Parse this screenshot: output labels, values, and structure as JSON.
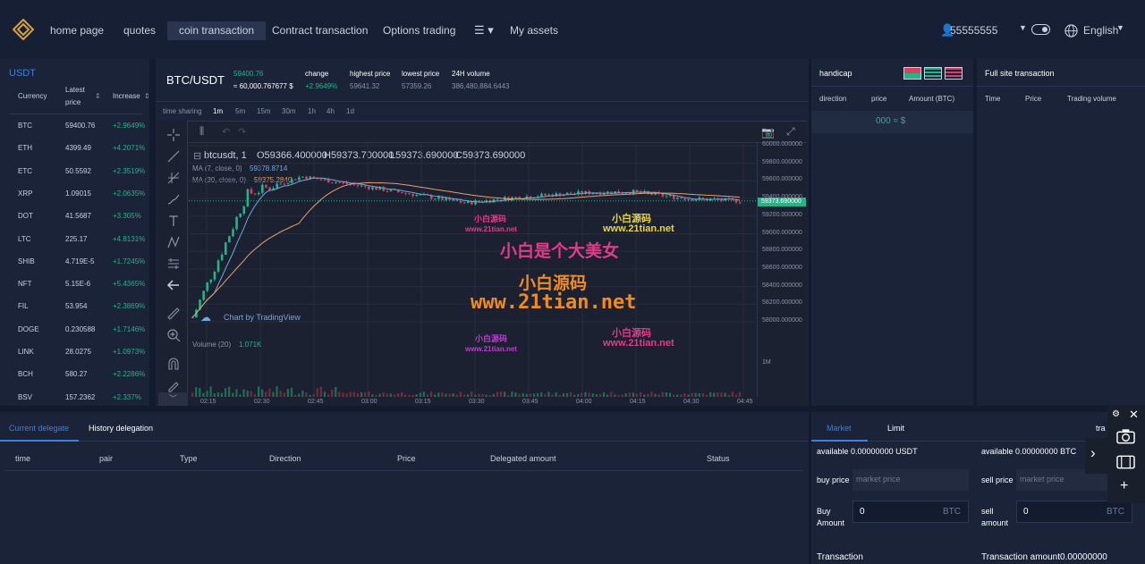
{
  "nav": {
    "items": [
      "home page",
      "quotes",
      "coin transaction",
      "Contract transaction",
      "Options trading",
      "My assets"
    ],
    "active": "coin transaction",
    "user": "55555555",
    "language": "English"
  },
  "market_list": {
    "title": "USDT",
    "headers": {
      "currency": "Currency",
      "latest_price_1": "Latest",
      "latest_price_2": "price",
      "increase": "Increase"
    },
    "rows": [
      {
        "currency": "BTC",
        "price": "59400.76",
        "increase": "+2.9649%"
      },
      {
        "currency": "ETH",
        "price": "4399.49",
        "increase": "+4.2071%"
      },
      {
        "currency": "ETC",
        "price": "50.5592",
        "increase": "+2.3519%"
      },
      {
        "currency": "XRP",
        "price": "1.09015",
        "increase": "+2.0635%"
      },
      {
        "currency": "DOT",
        "price": "41.5687",
        "increase": "+3.305%"
      },
      {
        "currency": "LTC",
        "price": "225.17",
        "increase": "+4.8131%"
      },
      {
        "currency": "SHIB",
        "price": "4.719E-5",
        "increase": "+1.7245%"
      },
      {
        "currency": "NFT",
        "price": "5.15E-6",
        "increase": "+5.4365%"
      },
      {
        "currency": "FIL",
        "price": "53.954",
        "increase": "+2.3869%"
      },
      {
        "currency": "DOGE",
        "price": "0.230588",
        "increase": "+1.7146%"
      },
      {
        "currency": "LINK",
        "price": "28.0275",
        "increase": "+1.0973%"
      },
      {
        "currency": "BCH",
        "price": "580.27",
        "increase": "+2.2286%"
      },
      {
        "currency": "BSV",
        "price": "157.2362",
        "increase": "+2.337%"
      }
    ]
  },
  "ticker": {
    "pair": "BTC/USDT",
    "last": "59400.76",
    "last_fiat": "≈ 60,000.767677 $",
    "change_label": "change",
    "change": "+2.9649%",
    "high_label": "highest price",
    "high": "59641.32",
    "low_label": "lowest price",
    "low": "57359.26",
    "vol_label": "24H volume",
    "vol": "386,480,884.6443"
  },
  "timeframes": [
    "time sharing",
    "1m",
    "5m",
    "15m",
    "30m",
    "1h",
    "4h",
    "1d"
  ],
  "active_timeframe": "1m",
  "chart": {
    "symbol": "btcusdt, 1",
    "ohlc": {
      "o": "O59366.400000",
      "h": "H59373.700000",
      "l": "L59373.690000",
      "c": "C59373.690000"
    },
    "ma7_label": "MA (7, close, 0)",
    "ma7_value": "59378.8714",
    "ma30_label": "MA (30, close, 0)",
    "ma30_value": "59375.2840",
    "volume_label": "Volume (20)",
    "volume_value": "1.071K",
    "credit": "Chart by TradingView",
    "last_price_tag": "59373.690000",
    "y_ticks": [
      "60000.000000",
      "59800.000000",
      "59600.000000",
      "59400.000000",
      "59200.000000",
      "59000.000000",
      "58800.000000",
      "58600.000000",
      "58400.000000",
      "58200.000000",
      "58000.000000"
    ],
    "vol_tick": "1M",
    "x_ticks": [
      "02:15",
      "02:30",
      "02:45",
      "03:00",
      "03:15",
      "03:30",
      "03:45",
      "04:00",
      "04:15",
      "04:30",
      "04:45"
    ],
    "watermarks": [
      "小白源码",
      "www.21tian.net",
      "小白源码",
      "www.21tian.net",
      "小白是个大美女",
      "小白源码",
      "www.21tian.net",
      "小白源码",
      "www.21tian.net",
      "小白源码",
      "www.21tian.net"
    ]
  },
  "chart_data": {
    "type": "line",
    "x": [
      "02:15",
      "02:30",
      "02:45",
      "03:00",
      "03:15",
      "03:30",
      "03:45",
      "04:00",
      "04:15",
      "04:30",
      "04:45"
    ],
    "series": [
      {
        "values": [
          58050,
          59450,
          59650,
          59550,
          59450,
          59350,
          59420,
          59460,
          59480,
          59400,
          59373.69
        ]
      }
    ],
    "ylim": [
      58000,
      60000
    ]
  },
  "handicap": {
    "title": "handicap",
    "col_direction": "direction",
    "col_price": "price",
    "col_amount": "Amount (BTC)",
    "mid": "000 ≈ $"
  },
  "full_site": {
    "title": "Full site transaction",
    "col_time": "Time",
    "col_price": "Price",
    "col_volume": "Trading volume"
  },
  "orders": {
    "tabs": [
      "Current delegate",
      "History delegation"
    ],
    "headers": [
      "time",
      "pair",
      "Type",
      "Direction",
      "Price",
      "Delegated amount",
      "Status"
    ]
  },
  "trade": {
    "tabs": [
      "Market",
      "Limit"
    ],
    "tab_right": "tra",
    "buy_available": "available 0.00000000 USDT",
    "sell_available": "available 0.00000000 BTC",
    "buy_price_label": "buy price",
    "sell_price_label": "sell price",
    "price_placeholder": "market price",
    "buy_amount_label_1": "Buy",
    "buy_amount_label_2": "Amount",
    "sell_amount_label_1": "sell",
    "sell_amount_label_2": "amount",
    "amount_value": "0",
    "unit": "BTC",
    "transaction_label": "Transaction",
    "transaction_amount": "Transaction amount0.00000000"
  }
}
